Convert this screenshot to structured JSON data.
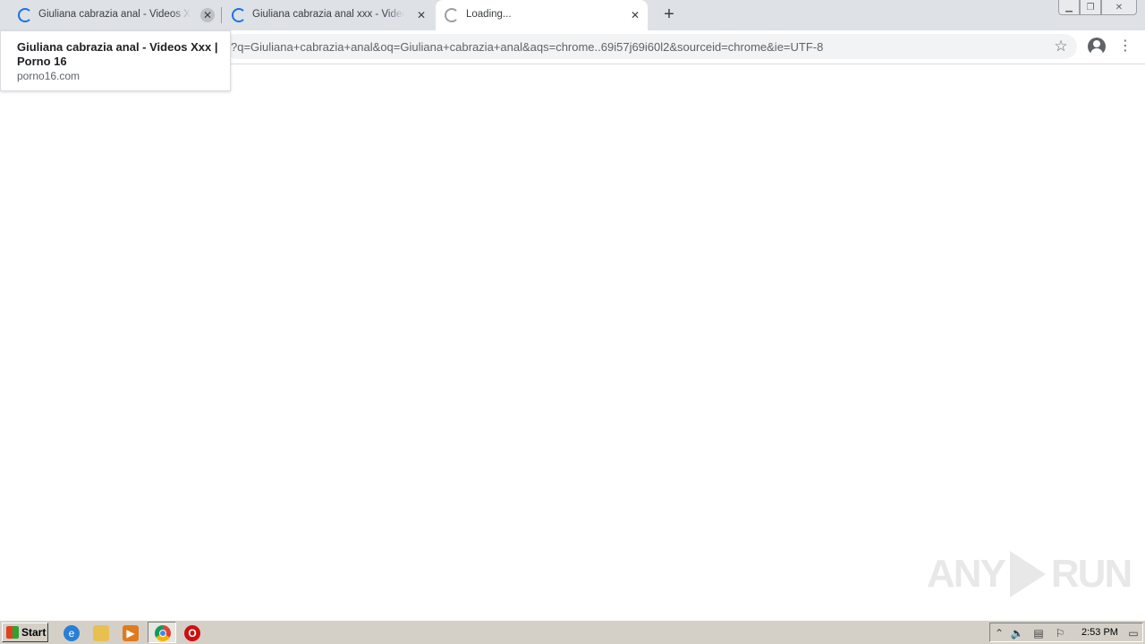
{
  "tabs": [
    {
      "title": "Giuliana cabrazia anal - Videos Xxx | Porno 16",
      "state": "loading"
    },
    {
      "title": "Giuliana cabrazia anal xxx - Videos Xxx",
      "state": "loading"
    },
    {
      "title": "Loading...",
      "state": "loading",
      "active": true
    }
  ],
  "address_bar": {
    "url": "?q=Giuliana+cabrazia+anal&oq=Giuliana+cabrazia+anal&aqs=chrome..69i57j69i60l2&sourceid=chrome&ie=UTF-8"
  },
  "hover_card": {
    "title": "Giuliana cabrazia anal - Videos Xxx | Porno 16",
    "domain": "porno16.com"
  },
  "watermark": {
    "left": "ANY",
    "right": "RUN"
  },
  "taskbar": {
    "start_label": "Start",
    "clock": "2:53 PM"
  },
  "icons": {
    "close": "close-icon",
    "new_tab": "plus-icon",
    "star": "star-icon",
    "profile": "account-icon",
    "menu": "kebab-menu-icon"
  },
  "colors": {
    "tabstrip": "#dee1e6",
    "spinner": "#1a73e8",
    "taskbar": "#d4d0c8"
  }
}
